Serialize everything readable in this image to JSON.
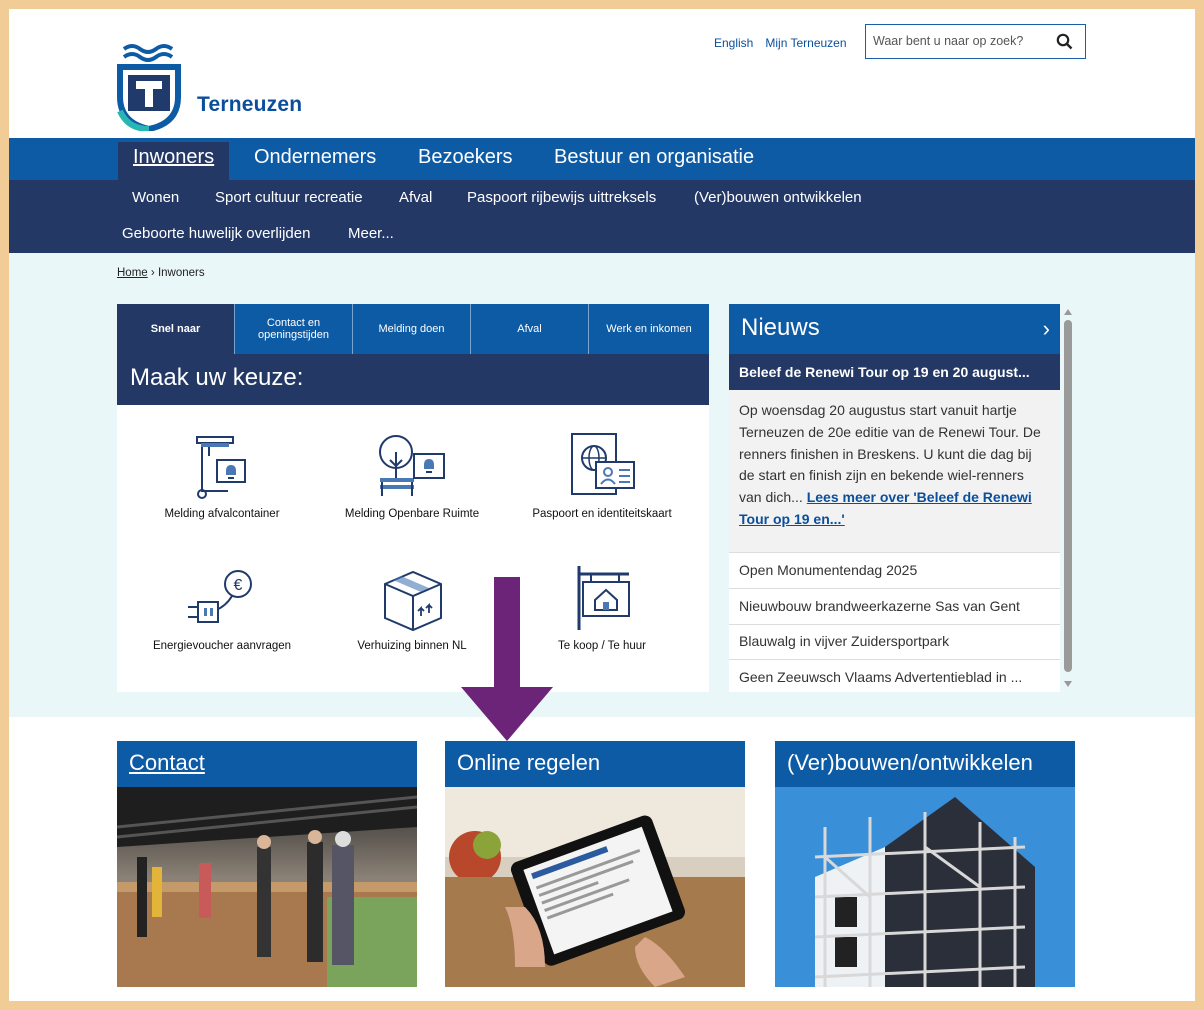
{
  "header": {
    "site_name": "Terneuzen",
    "links": [
      "English",
      "Mijn Terneuzen"
    ],
    "search_placeholder": "Waar bent u naar op zoek?"
  },
  "main_nav": [
    "Inwoners",
    "Ondernemers",
    "Bezoekers",
    "Bestuur en organisatie"
  ],
  "sub_nav": [
    "Wonen",
    "Sport cultuur recreatie",
    "Afval",
    "Paspoort rijbewijs uittreksels",
    "(Ver)bouwen ontwikkelen",
    "Geboorte huwelijk overlijden",
    "Meer..."
  ],
  "breadcrumb": {
    "home": "Home",
    "separator": "›",
    "current": "Inwoners"
  },
  "quick_panel": {
    "tabs": [
      "Snel naar",
      "Contact en openingstijden",
      "Melding doen",
      "Afval",
      "Werk en inkomen"
    ],
    "heading": "Maak uw keuze:",
    "tiles": [
      {
        "label": "Melding afvalcontainer",
        "icon": "container-bell-icon"
      },
      {
        "label": "Melding Openbare Ruimte",
        "icon": "tree-bench-bell-icon"
      },
      {
        "label": "Paspoort en identiteitskaart",
        "icon": "passport-id-icon"
      },
      {
        "label": "Energievoucher aanvragen",
        "icon": "plug-euro-icon"
      },
      {
        "label": "Verhuizing binnen NL",
        "icon": "moving-box-icon"
      },
      {
        "label": "Te koop / Te huur",
        "icon": "house-sign-icon"
      }
    ]
  },
  "news": {
    "title": "Nieuws",
    "chevron": "›",
    "featured_title": "Beleef de Renewi Tour op 19 en 20 august...",
    "featured_text": "Op woensdag 20 augustus start vanuit hartje Terneuzen de 20e editie van de Renewi Tour. De renners finishen in Breskens. U kunt die dag bij de start en finish zijn en bekende wiel-renners van dich...",
    "featured_more": "Lees meer over 'Beleef de Renewi Tour op 19 en...'",
    "items": [
      "Open Monumentendag 2025",
      "Nieuwbouw brandweerkazerne Sas van Gent",
      "Blauwalg in vijver Zuidersportpark",
      "Geen Zeeuwsch Vlaams Advertentieblad in ..."
    ]
  },
  "cards": [
    "Contact",
    "Online regelen",
    "(Ver)bouwen/ontwikkelen"
  ],
  "colors": {
    "brand_blue": "#0d5aa5",
    "dark_navy": "#243866",
    "arrow_purple": "#6b2477",
    "frame": "#f2cc96"
  }
}
